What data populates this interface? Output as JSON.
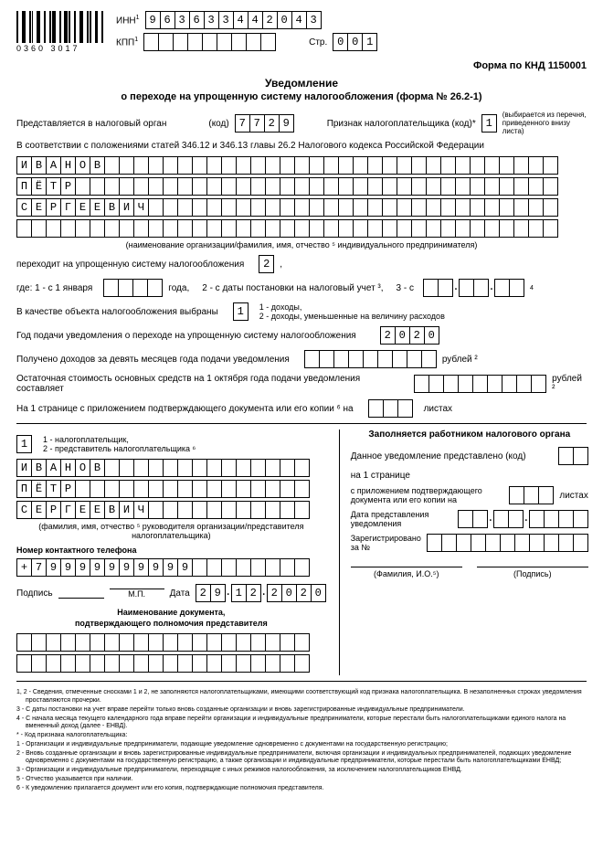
{
  "barcode_number": "0360 3017",
  "labels": {
    "inn": "ИНН",
    "kpp": "КПП",
    "str": "Стр."
  },
  "inn": [
    "9",
    "6",
    "3",
    "6",
    "3",
    "3",
    "4",
    "4",
    "2",
    "0",
    "4",
    "3"
  ],
  "kpp": [
    "",
    "",
    "",
    "",
    "",
    "",
    "",
    "",
    ""
  ],
  "page": [
    "0",
    "0",
    "1"
  ],
  "knd": "Форма по КНД 1150001",
  "title": "Уведомление",
  "subtitle": "о переходе на упрощенную систему налогообложения (форма № 26.2-1)",
  "r1": {
    "pre": "Представляется в налоговый орган",
    "kod": "(код)",
    "cells": [
      "7",
      "7",
      "2",
      "9"
    ],
    "priznak": "Признак налогоплательщика (код)*",
    "pcell": "1",
    "note": "(выбирается из перечня, приведенного внизу листа)"
  },
  "r2": "В соответствии с положениями статей 346.12 и 346.13 главы 26.2 Налогового кодекса Российской Федерации",
  "name_lines": [
    [
      "И",
      "В",
      "А",
      "Н",
      "О",
      "В",
      "",
      "",
      "",
      "",
      "",
      "",
      "",
      "",
      "",
      "",
      "",
      "",
      "",
      "",
      "",
      "",
      "",
      "",
      "",
      "",
      "",
      "",
      "",
      "",
      "",
      "",
      "",
      "",
      "",
      "",
      ""
    ],
    [
      "П",
      "Ё",
      "Т",
      "Р",
      "",
      "",
      "",
      "",
      "",
      "",
      "",
      "",
      "",
      "",
      "",
      "",
      "",
      "",
      "",
      "",
      "",
      "",
      "",
      "",
      "",
      "",
      "",
      "",
      "",
      "",
      "",
      "",
      "",
      "",
      "",
      "",
      ""
    ],
    [
      "С",
      "Е",
      "Р",
      "Г",
      "Е",
      "Е",
      "В",
      "И",
      "Ч",
      "",
      "",
      "",
      "",
      "",
      "",
      "",
      "",
      "",
      "",
      "",
      "",
      "",
      "",
      "",
      "",
      "",
      "",
      "",
      "",
      "",
      "",
      "",
      "",
      "",
      "",
      "",
      ""
    ],
    [
      "",
      "",
      "",
      "",
      "",
      "",
      "",
      "",
      "",
      "",
      "",
      "",
      "",
      "",
      "",
      "",
      "",
      "",
      "",
      "",
      "",
      "",
      "",
      "",
      "",
      "",
      "",
      "",
      "",
      "",
      "",
      "",
      "",
      "",
      "",
      "",
      ""
    ]
  ],
  "cap_name": "(наименование организации/фамилия, имя, отчество ⁵ индивидуального предпринимателя)",
  "r3": {
    "a": "переходит на упрощенную систему налогообложения",
    "c": "2",
    "b": ","
  },
  "r4": {
    "a": "где: 1 - с 1 января",
    "b": "года,",
    "c": "2 - с даты постановки на налоговый учет ³,",
    "d": "3 - с"
  },
  "r5": {
    "a": "В качестве объекта налогообложения выбраны",
    "c": "1",
    "b": "1 - доходы,",
    "d": "2 - доходы, уменьшенные на величину расходов"
  },
  "r6": {
    "a": "Год подачи уведомления о переходе на упрощенную систему налогообложения",
    "c": [
      "2",
      "0",
      "2",
      "0"
    ]
  },
  "r7": {
    "a": "Получено доходов за девять месяцев года подачи уведомления",
    "b": "рублей ²"
  },
  "r8": {
    "a": "Остаточная стоимость основных средств на 1 октября года подачи уведомления составляет",
    "b": "рублей ²"
  },
  "r9": {
    "a": "На 1 странице с приложением подтверждающего документа или его копии ⁶ на",
    "b": "листах"
  },
  "left": {
    "c": "1",
    "opt1": "1 - налогоплательщик,",
    "opt2": "2 - представитель налогоплательщика ⁶",
    "lines": [
      [
        "И",
        "В",
        "А",
        "Н",
        "О",
        "В",
        "",
        "",
        "",
        "",
        "",
        "",
        "",
        "",
        "",
        "",
        "",
        "",
        "",
        ""
      ],
      [
        "П",
        "Ё",
        "Т",
        "Р",
        "",
        "",
        "",
        "",
        "",
        "",
        "",
        "",
        "",
        "",
        "",
        "",
        "",
        "",
        "",
        ""
      ],
      [
        "С",
        "Е",
        "Р",
        "Г",
        "Е",
        "Е",
        "В",
        "И",
        "Ч",
        "",
        "",
        "",
        "",
        "",
        "",
        "",
        "",
        "",
        "",
        ""
      ]
    ],
    "cap": "(фамилия, имя, отчество ⁵ руководителя организации/представителя налогоплательщика)",
    "tel_lbl": "Номер контактного телефона",
    "tel": [
      "+",
      "7",
      "9",
      "9",
      "9",
      "9",
      "9",
      "9",
      "9",
      "9",
      "9",
      "9",
      "",
      "",
      "",
      "",
      "",
      "",
      "",
      ""
    ],
    "sig": "Подпись",
    "mp": "М.П.",
    "date_lbl": "Дата",
    "date": [
      "2",
      "9",
      ".",
      "1",
      "2",
      ".",
      "2",
      "0",
      "2",
      "0"
    ],
    "doc_t": "Наименование документа,",
    "doc_t2": "подтверждающего полномочия представителя",
    "doc_lines": [
      [
        "",
        "",
        "",
        "",
        "",
        "",
        "",
        "",
        "",
        "",
        "",
        "",
        "",
        "",
        "",
        "",
        "",
        "",
        "",
        ""
      ],
      [
        "",
        "",
        "",
        "",
        "",
        "",
        "",
        "",
        "",
        "",
        "",
        "",
        "",
        "",
        "",
        "",
        "",
        "",
        "",
        ""
      ]
    ]
  },
  "right": {
    "title": "Заполняется работником налогового органа",
    "r1": "Данное уведомление представлено (код)",
    "r2": "на 1 странице",
    "r3a": "с приложением подтверждающего",
    "r3b": "документа или его копии на",
    "r3c": "листах",
    "r4a": "Дата представления",
    "r4b": "уведомления",
    "r5a": "Зарегистрировано",
    "r5b": "за №",
    "sig1": "(Фамилия, И.О.⁵)",
    "sig2": "(Подпись)"
  },
  "footnotes": [
    "1, 2 - Сведения, отмеченные сносками 1 и 2, не заполняются налогоплательщиками, имеющими соответствующий код признака налогоплательщика. В незаполненных строках уведомления проставляются прочерки.",
    "3 - С даты постановки на учет вправе перейти только вновь созданные организации и вновь зарегистрированные индивидуальные предприниматели.",
    "4 - С начала месяца текущего календарного года вправе перейти организации и индивидуальные предприниматели, которые перестали быть налогоплательщиками единого налога на вмененный доход (далее - ЕНВД).",
    "* - Код признака налогоплательщика:",
    "1 - Организации и индивидуальные предприниматели, подающие уведомление одновременно с документами на государственную регистрацию;",
    "2 - Вновь созданные организации и вновь зарегистрированные индивидуальные предприниматели, включая организации и индивидуальных предпринимателей, подающих уведомление одновременно с документами на государственную регистрацию, а также организации и индивидуальные предприниматели, которые перестали быть налогоплательщиками ЕНВД;",
    "3 - Организации и индивидуальные предприниматели, переходящие с иных режимов налогообложения, за исключением налогоплательщиков ЕНВД.",
    "5 - Отчество указывается при наличии.",
    "6 - К уведомлению прилагается документ или его копия, подтверждающие полномочия представителя."
  ]
}
